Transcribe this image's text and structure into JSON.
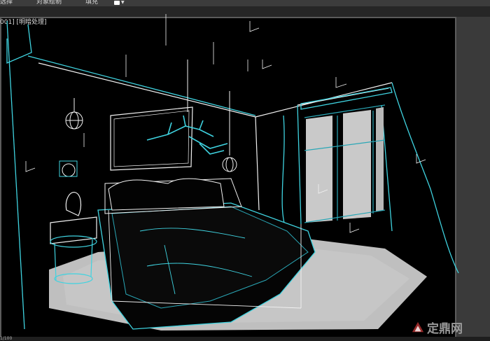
{
  "menu": {
    "item1": "选择",
    "item2": "对象绘制",
    "item3": "填充"
  },
  "dropdown_icon": "camera-icon",
  "viewport": {
    "label": "001] [明暗处理]"
  },
  "status": {
    "text": "1/100"
  },
  "watermark": {
    "text": "定鼎网"
  },
  "colors": {
    "wire_white": "#f2f2f2",
    "wire_cyan": "#3fd3e0",
    "wire_teal": "#2aa7b6",
    "window_glass": "#c9c9c9",
    "rug": "#bfbfbf",
    "background": "#000000"
  }
}
